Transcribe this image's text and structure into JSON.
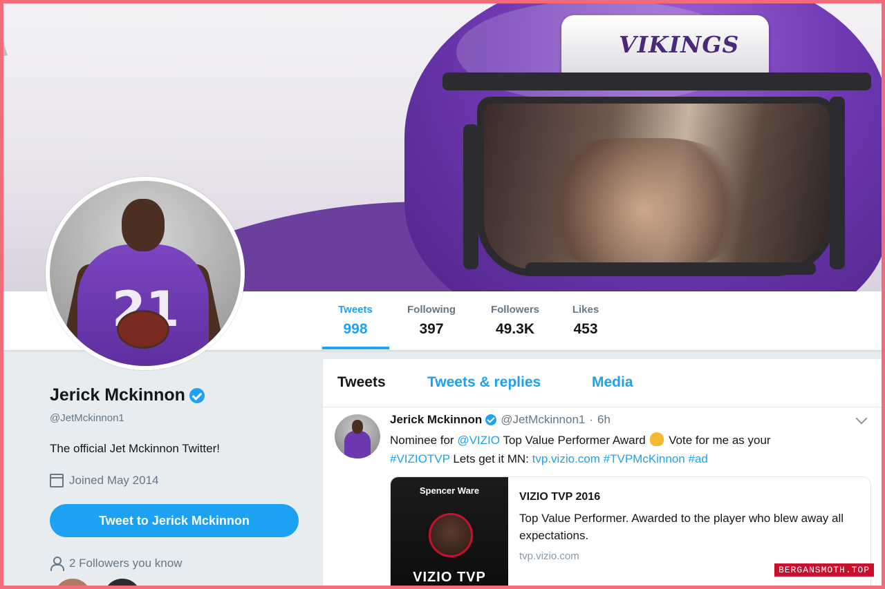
{
  "banner": {
    "helmet_logo_text": "VIKINGS"
  },
  "profile_nav": {
    "stats": [
      {
        "label": "Tweets",
        "value": "998",
        "active": true
      },
      {
        "label": "Following",
        "value": "397",
        "active": false
      },
      {
        "label": "Followers",
        "value": "49.3K",
        "active": false
      },
      {
        "label": "Likes",
        "value": "453",
        "active": false
      }
    ]
  },
  "profile": {
    "display_name": "Jerick Mckinnon",
    "handle": "@JetMckinnon1",
    "bio": "The official Jet Mckinnon Twitter!",
    "joined": "Joined May 2014",
    "tweet_to_label": "Tweet to Jerick Mckinnon",
    "followers_you_know": "2 Followers you know",
    "avatar_jersey_number": "21"
  },
  "timeline": {
    "tabs": [
      {
        "label": "Tweets",
        "active": true
      },
      {
        "label": "Tweets & replies",
        "active": false
      },
      {
        "label": "Media",
        "active": false
      }
    ],
    "tweet": {
      "name": "Jerick Mckinnon",
      "handle": "@JetMckinnon1",
      "dot": "·",
      "time": "6h",
      "text": {
        "t1": "Nominee for ",
        "link1": "@VIZIO",
        "t2": " Top Value Performer Award ",
        "t3": " Vote for me as your ",
        "link2": "#VIZIOTVP",
        "t4": " Lets get it MN: ",
        "link3": "tvp.vizio.com",
        "t5": " ",
        "link4": "#TVPMcKinnon",
        "t6": " ",
        "link5": "#ad"
      },
      "card": {
        "image_name": "Spencer Ware",
        "image_brand": "VIZIO TVP",
        "title": "VIZIO TVP 2016",
        "description": "Top Value Performer. Awarded to the player who blew away all expectations.",
        "url": "tvp.vizio.com"
      }
    }
  },
  "watermark": "BERGANSMOTH.TOP",
  "colors": {
    "accent": "#1da1f2",
    "frame": "#f26b7a",
    "vikings_purple": "#6e38b2",
    "text_primary": "#14171a",
    "text_secondary": "#657786"
  },
  "icons": [
    "verified-badge-icon",
    "calendar-icon",
    "person-icon",
    "chevron-down-icon",
    "clap-emoji-icon"
  ]
}
